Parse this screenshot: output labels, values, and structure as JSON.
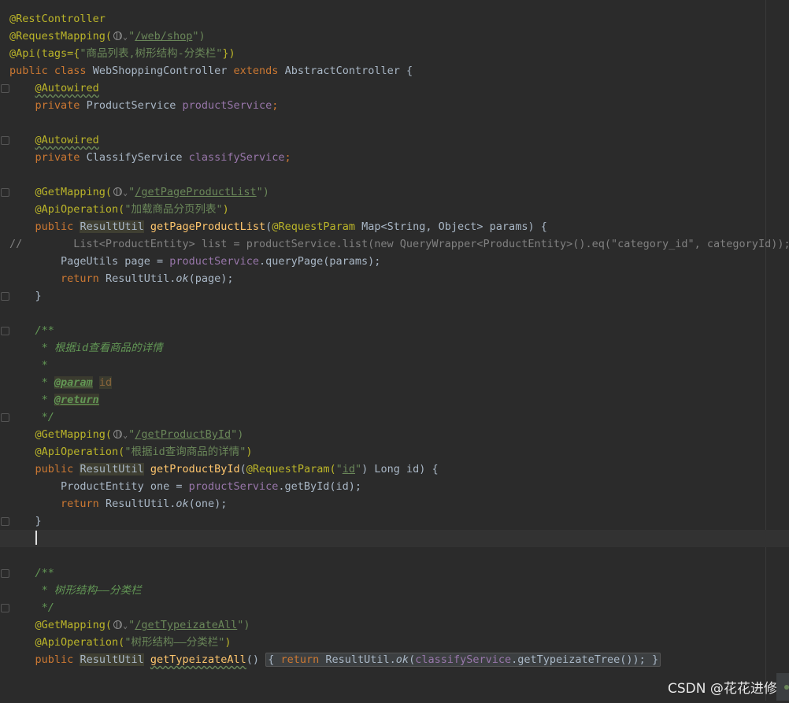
{
  "code": {
    "ann_rest_controller": "@RestController",
    "ann_request_mapping": "@RequestMapping(",
    "path_web_shop": "/web/shop",
    "ann_api": "@Api(tags={",
    "tags_value": "\"商品列表,树形结构-分类栏\"",
    "ann_api_end": "})",
    "kw_public": "public",
    "kw_class": "class",
    "class_name": "WebShoppingController",
    "kw_extends": "extends",
    "parent_class": "AbstractController {",
    "ann_autowired": "@Autowired",
    "kw_private": "private",
    "type_product_service": "ProductService",
    "field_product_service": "productService",
    "type_classify_service": "ClassifyService",
    "field_classify_service": "classifyService",
    "ann_get_mapping": "@GetMapping(",
    "path_get_page_product_list": "/getPageProductList",
    "ann_api_operation": "@ApiOperation(",
    "op_load_products": "\"加载商品分页列表\"",
    "type_result_util": "ResultUtil",
    "method_get_page_product_list": "getPageProductList",
    "ann_request_param": "@RequestParam",
    "params_sig": "Map<String, Object> params) {",
    "commented_line": "//        List<ProductEntity> list = productService.list(new QueryWrapper<ProductEntity>().eq(\"category_id\", categoryId));",
    "page_utils_line_a": "PageUtils page = ",
    "query_page_call": ".queryPage(params);",
    "kw_return": "return",
    "result_util_dot": "ResultUtil.",
    "ok": "ok",
    "ok_page_args": "(page);",
    "close_brace": "}",
    "doc_open": "/**",
    "doc_by_id_desc": " * 根据id查看商品的详情",
    "doc_star": " *",
    "doc_star_prefix": " * ",
    "doc_param_tag": "@param",
    "doc_param_name": "id",
    "doc_return_tag": "@return",
    "doc_close": " */",
    "path_get_product_by_id": "/getProductById",
    "op_product_by_id": "\"根据id查询商品的详情\"",
    "method_get_product_by_id": "getProductById",
    "request_param_open": "(",
    "param_id_str": "id",
    "long_id_sig": ") Long id) {",
    "product_entity_line_a": "ProductEntity one = ",
    "get_by_id_call": ".getById(id);",
    "ok_one_args": "(one);",
    "doc_tree_desc": " * 树形结构——分类栏",
    "path_get_typeizate_all": "/getTypeizateAll",
    "op_tree": "\"树形结构——分类栏\"",
    "method_get_typeizate_all": "getTypeizateAll",
    "get_typeizate_tree_call": ".getTypeizateTree());",
    "open_brace": "{",
    "quote": "\"",
    "close_paren_str": "\")",
    "empty_parens": "()",
    "semicolon": ";"
  },
  "watermark": "CSDN @花花进修"
}
